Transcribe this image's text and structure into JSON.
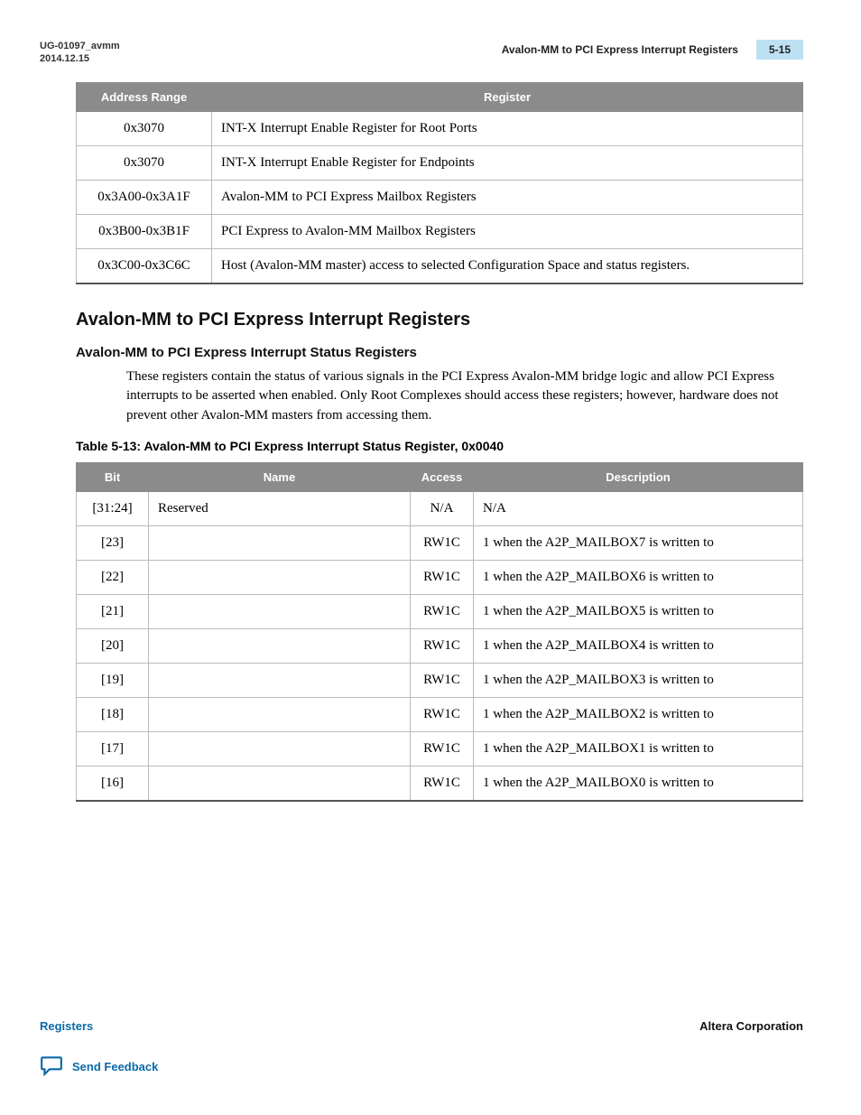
{
  "header": {
    "doc_id": "UG-01097_avmm",
    "date": "2014.12.15",
    "section_title": "Avalon-MM to PCI Express Interrupt Registers",
    "page_num": "5-15"
  },
  "table1": {
    "headers": [
      "Address Range",
      "Register"
    ],
    "rows": [
      [
        "0x3070",
        "INT-X Interrupt Enable Register for Root Ports"
      ],
      [
        "0x3070",
        "INT-X Interrupt Enable Register for Endpoints"
      ],
      [
        "0x3A00-0x3A1F",
        "Avalon-MM to PCI Express Mailbox Registers"
      ],
      [
        "0x3B00-0x3B1F",
        "PCI Express to Avalon-MM Mailbox Registers"
      ],
      [
        "0x3C00-0x3C6C",
        "Host (Avalon-MM master) access to selected Configuration Space and status registers."
      ]
    ]
  },
  "h2": "Avalon-MM to PCI Express Interrupt Registers",
  "h3": "Avalon-MM to PCI Express Interrupt Status Registers",
  "para": "These registers contain the status of various signals in the PCI Express Avalon-MM bridge logic and allow PCI Express interrupts to be asserted when enabled. Only Root Complexes should access these registers; however, hardware does not prevent other Avalon-MM masters from accessing them.",
  "table2_caption": "Table 5-13: Avalon-MM to PCI Express Interrupt Status Register, 0x0040",
  "table2": {
    "headers": [
      "Bit",
      "Name",
      "Access",
      "Description"
    ],
    "rows": [
      [
        "[31:24]",
        "Reserved",
        "N/A",
        "N/A"
      ],
      [
        "[23]",
        "",
        "RW1C",
        "1 when the A2P_MAILBOX7 is written to"
      ],
      [
        "[22]",
        "",
        "RW1C",
        "1 when the A2P_MAILBOX6 is written to"
      ],
      [
        "[21]",
        "",
        "RW1C",
        "1 when the A2P_MAILBOX5 is written to"
      ],
      [
        "[20]",
        "",
        "RW1C",
        "1 when the A2P_MAILBOX4 is written to"
      ],
      [
        "[19]",
        "",
        "RW1C",
        "1 when the A2P_MAILBOX3 is written to"
      ],
      [
        "[18]",
        "",
        "RW1C",
        "1 when the A2P_MAILBOX2 is written to"
      ],
      [
        "[17]",
        "",
        "RW1C",
        "1 when the A2P_MAILBOX1 is written to"
      ],
      [
        "[16]",
        "",
        "RW1C",
        "1 when the A2P_MAILBOX0 is written to"
      ]
    ]
  },
  "footer": {
    "left": "Registers",
    "right": "Altera Corporation",
    "feedback": "Send Feedback"
  }
}
